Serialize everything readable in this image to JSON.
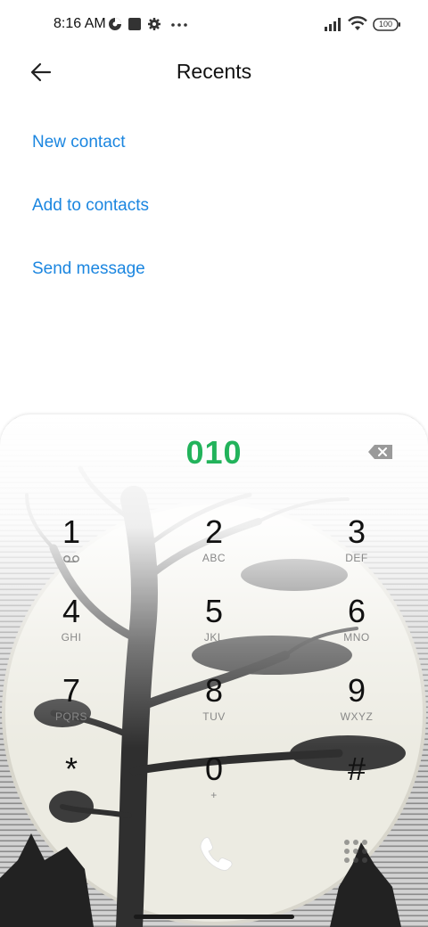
{
  "status": {
    "time": "8:16 AM",
    "battery": "100"
  },
  "header": {
    "title": "Recents"
  },
  "actions": [
    {
      "label": "New contact"
    },
    {
      "label": "Add to contacts"
    },
    {
      "label": "Send message"
    }
  ],
  "dialpad": {
    "number": "010",
    "keys": [
      {
        "digit": "1",
        "letters": ""
      },
      {
        "digit": "2",
        "letters": "ABC"
      },
      {
        "digit": "3",
        "letters": "DEF"
      },
      {
        "digit": "4",
        "letters": "GHI"
      },
      {
        "digit": "5",
        "letters": "JKL"
      },
      {
        "digit": "6",
        "letters": "MNO"
      },
      {
        "digit": "7",
        "letters": "PQRS"
      },
      {
        "digit": "8",
        "letters": "TUV"
      },
      {
        "digit": "9",
        "letters": "WXYZ"
      },
      {
        "digit": "*",
        "letters": ""
      },
      {
        "digit": "0",
        "letters": "+"
      },
      {
        "digit": "#",
        "letters": ""
      }
    ]
  },
  "colors": {
    "accent": "#1b86e0",
    "number": "#22b35b",
    "call": "#ffffff"
  },
  "icons": [
    "back-arrow-icon",
    "backspace-icon",
    "voicemail-icon",
    "phone-icon",
    "dialpad-toggle-icon",
    "signal-icon",
    "wifi-icon",
    "battery-icon",
    "settings-icon"
  ]
}
